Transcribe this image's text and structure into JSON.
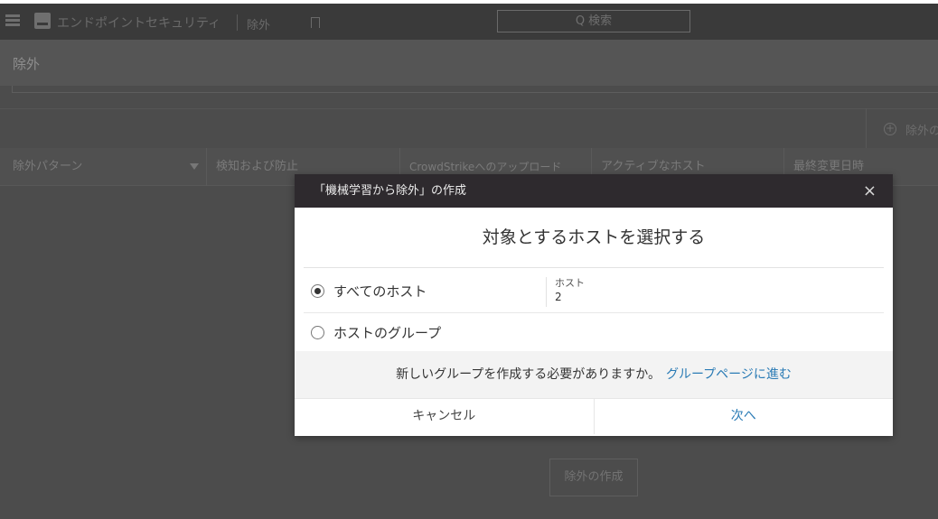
{
  "topbar": {
    "app_title": "エンドポイントセキュリティ",
    "breadcrumb": "除外",
    "search_placeholder": "Q 検索"
  },
  "page": {
    "heading": "除外",
    "add_button_label": "除外の",
    "table_headers": [
      "除外パターン",
      "検知および防止",
      "CrowdStrikeへのアップロード",
      "アクティブなホスト",
      "最終変更日時"
    ],
    "create_button_label": "除外の作成"
  },
  "modal": {
    "title": "「機械学習から除外」の作成",
    "close_label": "×",
    "subtitle": "対象とするホストを選択する",
    "options": [
      {
        "label": "すべてのホスト",
        "checked": true,
        "host_label": "ホスト",
        "host_count": "2"
      },
      {
        "label": "ホストのグループ",
        "checked": false
      }
    ],
    "note_text": "新しいグループを作成する必要がありますか。",
    "note_link": "グループページに進む",
    "cancel_label": "キャンセル",
    "next_label": "次へ"
  }
}
